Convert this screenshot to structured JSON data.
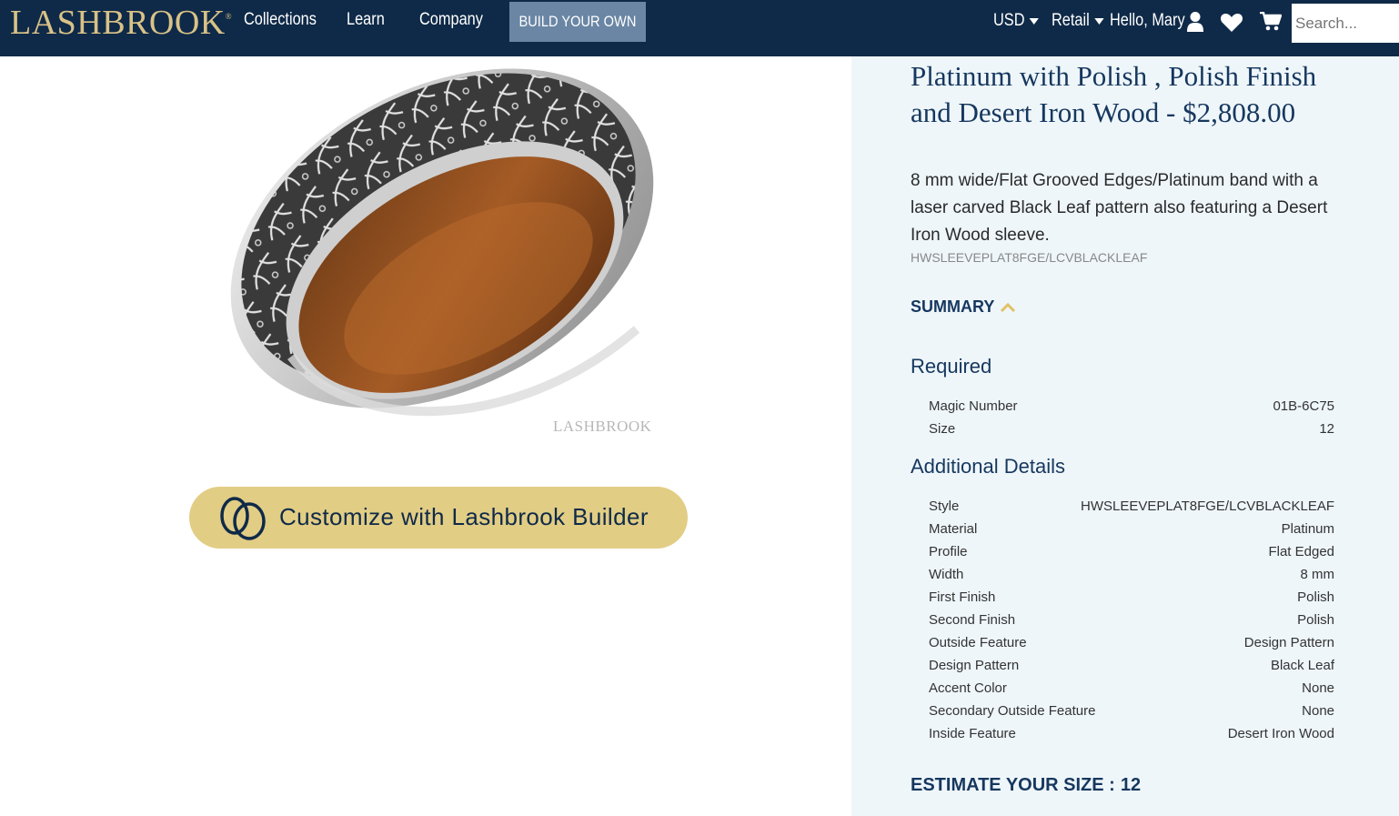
{
  "header": {
    "logo": "LASHBROOK",
    "logo_mark": "®",
    "nav": [
      "Collections",
      "Learn",
      "Company"
    ],
    "build_button": "BUILD YOUR OWN",
    "currency": "USD",
    "pricing": "Retail",
    "greeting": "Hello, Mary",
    "search_placeholder": "Search..."
  },
  "product": {
    "image_watermark": "LASHBROOK",
    "builder_button": "Customize with Lashbrook Builder",
    "title": "Platinum with Polish , Polish Finish and Desert Iron Wood - $2,808.00",
    "description": "8 mm wide/Flat Grooved Edges/Platinum band with a laser carved Black Leaf pattern also featuring a Desert Iron Wood sleeve.",
    "sku": "HWSLEEVEPLAT8FGE/LCVBLACKLEAF",
    "summary_label": "SUMMARY"
  },
  "required": {
    "title": "Required",
    "rows": [
      {
        "k": "Magic Number",
        "v": "01B-6C75"
      },
      {
        "k": "Size",
        "v": "12"
      }
    ]
  },
  "additional": {
    "title": "Additional Details",
    "rows": [
      {
        "k": "Style",
        "v": "HWSLEEVEPLAT8FGE/LCVBLACKLEAF"
      },
      {
        "k": "Material",
        "v": "Platinum"
      },
      {
        "k": "Profile",
        "v": "Flat Edged"
      },
      {
        "k": "Width",
        "v": "8 mm"
      },
      {
        "k": "First Finish",
        "v": "Polish"
      },
      {
        "k": "Second Finish",
        "v": "Polish"
      },
      {
        "k": "Outside Feature",
        "v": "Design Pattern"
      },
      {
        "k": "Design Pattern",
        "v": "Black Leaf"
      },
      {
        "k": "Accent Color",
        "v": "None"
      },
      {
        "k": "Secondary Outside Feature",
        "v": "None"
      },
      {
        "k": "Inside Feature",
        "v": "Desert Iron Wood"
      }
    ]
  },
  "estimate": {
    "label": "ESTIMATE YOUR SIZE :",
    "value": "12"
  },
  "colors": {
    "navy": "#0f2a48",
    "gold": "#d9c287",
    "button_gold": "#e2cd85",
    "panel": "#eef6fa"
  },
  "icons": [
    "user-icon",
    "heart-icon",
    "cart-icon",
    "chevron-up-icon",
    "interlocking-rings-icon"
  ]
}
